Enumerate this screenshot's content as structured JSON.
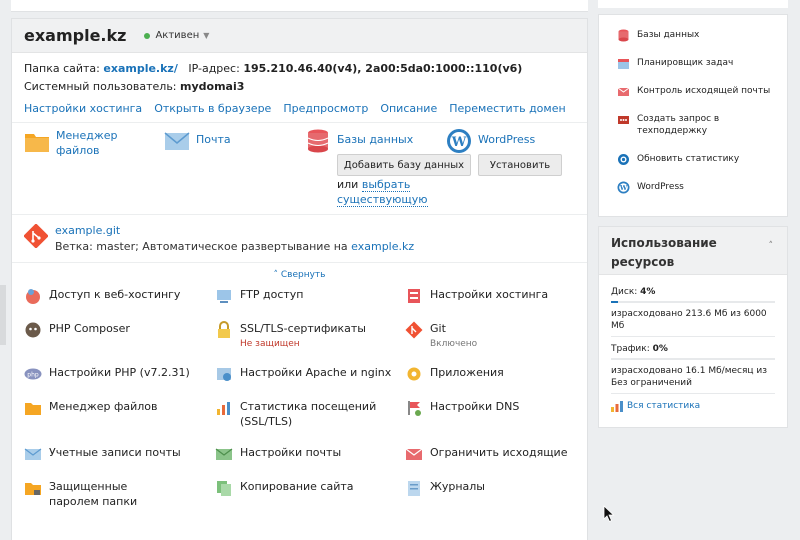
{
  "domain": {
    "name": "example.kz",
    "status": "Активен",
    "folder_label": "Папка сайта:",
    "folder_value": "example.kz/",
    "ip_label": "IP-адрес:",
    "ip_value": "195.210.46.40(v4), 2a00:5da0:1000::110(v6)",
    "user_label": "Системный пользователь:",
    "user_value": "mydomai3"
  },
  "links": [
    "Настройки хостинга",
    "Открыть в браузере",
    "Предпросмотр",
    "Описание",
    "Переместить домен"
  ],
  "tools": {
    "file_manager": "Менеджер файлов",
    "mail": "Почта",
    "databases": "Базы данных",
    "wordpress": "WordPress",
    "add_db": "Добавить базу данных",
    "install": "Установить",
    "or": "или",
    "choose_existing": "выбрать существующую"
  },
  "git": {
    "repo": "example.git",
    "branch_text": "Ветка: master; Автоматическое развертывание на",
    "branch_link": "example.kz"
  },
  "collapse_label": "Свернуть",
  "grid": [
    {
      "label": "Доступ к веб-хостингу",
      "sub": ""
    },
    {
      "label": "FTP доступ",
      "sub": ""
    },
    {
      "label": "Настройки хостинга",
      "sub": ""
    },
    {
      "label": "PHP Composer",
      "sub": ""
    },
    {
      "label": "SSL/TLS-сертификаты",
      "sub": "Не защищен"
    },
    {
      "label": "Git",
      "sub": "Включено"
    },
    {
      "label": "Настройки PHP (v7.2.31)",
      "sub": ""
    },
    {
      "label": "Настройки Apache и nginx",
      "sub": ""
    },
    {
      "label": "Приложения",
      "sub": ""
    },
    {
      "label": "Менеджер файлов",
      "sub": ""
    },
    {
      "label": "Статистика посещений (SSL/TLS)",
      "sub": ""
    },
    {
      "label": "Настройки DNS",
      "sub": ""
    },
    {
      "label": "Учетные записи почты",
      "sub": ""
    },
    {
      "label": "Настройки почты",
      "sub": ""
    },
    {
      "label": "Ограничить исходящие",
      "sub": ""
    },
    {
      "label": "Защищенные паролем папки",
      "sub": ""
    },
    {
      "label": "Копирование сайта",
      "sub": ""
    },
    {
      "label": "Журналы",
      "sub": ""
    }
  ],
  "sidebar": [
    "Базы данных",
    "Планировщик задач",
    "Контроль исходящей почты",
    "Создать запрос в техподдержку",
    "Обновить статистику",
    "WordPress"
  ],
  "resources": {
    "title": "Использование ресурсов",
    "disk_label": "Диск:",
    "disk_value": "4%",
    "disk_percent": 4,
    "disk_used": "израсходовано 213.6 Мб из 6000 Мб",
    "traffic_label": "Трафик:",
    "traffic_value": "0%",
    "traffic_percent": 0,
    "traffic_used": "израсходовано 16.1 Мб/месяц из Без ограничений",
    "all_stats": "Вся статистика"
  },
  "colors": {
    "link": "#1a72b8",
    "active": "#4caf50",
    "warning": "#c0392b"
  }
}
